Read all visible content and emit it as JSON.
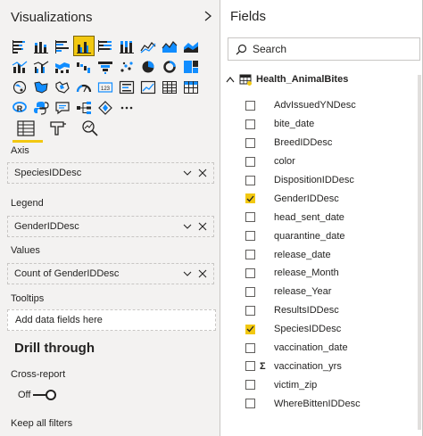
{
  "visualizations": {
    "title": "Visualizations",
    "collapse_icon": "chevron-right-icon",
    "icons": [
      [
        "stacked-bar-icon",
        "stacked-column-icon",
        "clustered-bar-icon",
        "clustered-column-icon",
        "100-stacked-bar-icon",
        "100-stacked-column-icon",
        "line-chart-icon",
        "area-chart-icon",
        "stacked-area-icon"
      ],
      [
        "line-stacked-column-icon",
        "line-clustered-column-icon",
        "ribbon-chart-icon",
        "waterfall-icon",
        "funnel-icon",
        "scatter-icon",
        "pie-icon",
        "donut-icon",
        "treemap-icon"
      ],
      [
        "map-icon",
        "filled-map-icon",
        "shape-map-icon",
        "gauge-icon",
        "card-icon",
        "multi-row-card-icon",
        "kpi-icon",
        "table-icon",
        "matrix-icon"
      ],
      [
        "r-visual-icon",
        "python-visual-icon",
        "qa-icon",
        "decomposition-tree-icon",
        "key-influencers-icon",
        "ellipsis-icon"
      ]
    ],
    "selected_icon": "clustered-column-icon",
    "tabs": [
      "fields-tab-icon",
      "format-tab-icon",
      "analytics-tab-icon"
    ],
    "wells": {
      "axis": {
        "label": "Axis",
        "value": "SpeciesIDDesc"
      },
      "legend": {
        "label": "Legend",
        "value": "GenderIDDesc"
      },
      "values": {
        "label": "Values",
        "value": "Count of GenderIDDesc"
      },
      "tooltips": {
        "label": "Tooltips",
        "placeholder": "Add data fields here"
      }
    },
    "drill": {
      "title": "Drill through",
      "cross_report": "Cross-report",
      "toggle_state": "Off",
      "keep_all_filters": "Keep all filters"
    }
  },
  "fields": {
    "title": "Fields",
    "search_placeholder": "Search",
    "table_name": "Health_AnimalBites",
    "items": [
      {
        "name": "AdvIssuedYNDesc",
        "checked": false,
        "sigma": false
      },
      {
        "name": "bite_date",
        "checked": false,
        "sigma": false
      },
      {
        "name": "BreedIDDesc",
        "checked": false,
        "sigma": false
      },
      {
        "name": "color",
        "checked": false,
        "sigma": false
      },
      {
        "name": "DispositionIDDesc",
        "checked": false,
        "sigma": false
      },
      {
        "name": "GenderIDDesc",
        "checked": true,
        "sigma": false
      },
      {
        "name": "head_sent_date",
        "checked": false,
        "sigma": false
      },
      {
        "name": "quarantine_date",
        "checked": false,
        "sigma": false
      },
      {
        "name": "release_date",
        "checked": false,
        "sigma": false
      },
      {
        "name": "release_Month",
        "checked": false,
        "sigma": false
      },
      {
        "name": "release_Year",
        "checked": false,
        "sigma": false
      },
      {
        "name": "ResultsIDDesc",
        "checked": false,
        "sigma": false
      },
      {
        "name": "SpeciesIDDesc",
        "checked": true,
        "sigma": false
      },
      {
        "name": "vaccination_date",
        "checked": false,
        "sigma": false
      },
      {
        "name": "vaccination_yrs",
        "checked": false,
        "sigma": true
      },
      {
        "name": "victim_zip",
        "checked": false,
        "sigma": false
      },
      {
        "name": "WhereBittenIDDesc",
        "checked": false,
        "sigma": false
      }
    ]
  },
  "colors": {
    "accent": "#f2c811",
    "pane": "#f3f2f1",
    "text": "#252423"
  }
}
